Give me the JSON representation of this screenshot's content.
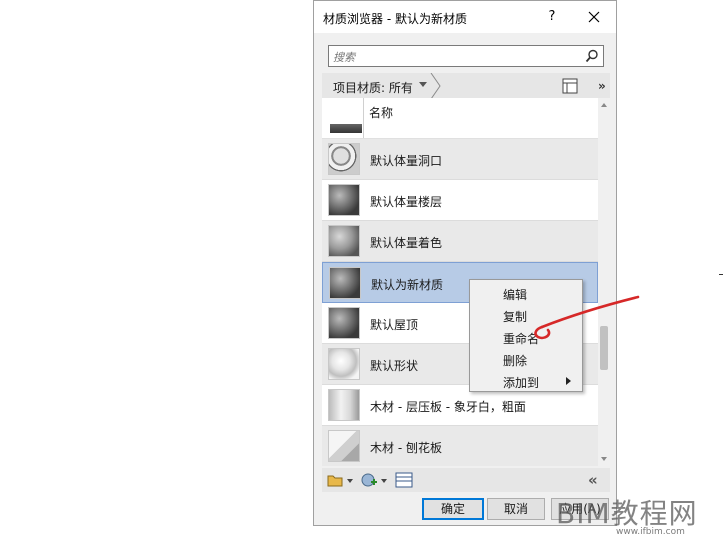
{
  "window": {
    "title": "材质浏览器 - 默认为新材质",
    "help_label": "?"
  },
  "search": {
    "placeholder": "搜索",
    "value": ""
  },
  "filter": {
    "label": "项目材质: 所有"
  },
  "list": {
    "column_header": "名称",
    "items": [
      {
        "label": "默认体量洞口",
        "thumbnail": "holes-sphere"
      },
      {
        "label": "默认体量楼层",
        "thumbnail": "dark-sphere"
      },
      {
        "label": "默认体量着色",
        "thumbnail": "mid-sphere"
      },
      {
        "label": "默认为新材质",
        "thumbnail": "dark-sphere",
        "selected": true
      },
      {
        "label": "默认屋顶",
        "thumbnail": "dark-sphere"
      },
      {
        "label": "默认形状",
        "thumbnail": "glass-sphere"
      },
      {
        "label": "木材 - 层压板 - 象牙白，粗面",
        "thumbnail": "cylinder"
      },
      {
        "label": "木材 - 刨花板",
        "thumbnail": "cube"
      }
    ],
    "scroll_fraction": 0.62
  },
  "context_menu": {
    "items": [
      {
        "label": "编辑"
      },
      {
        "label": "复制"
      },
      {
        "label": "重命名"
      },
      {
        "label": "删除"
      },
      {
        "label": "添加到",
        "has_submenu": true
      }
    ]
  },
  "buttons": {
    "ok": "确定",
    "cancel": "取消",
    "apply": "应用(A)"
  },
  "watermark": {
    "logo": "BIM教程网",
    "url": "www.ifbim.com"
  },
  "colors": {
    "selection": "#b7cbe6",
    "focus_border": "#0078d7",
    "annotation": "#d62828"
  },
  "icons": {
    "search": "magnifier-icon",
    "close": "x-icon",
    "layout": "panel-layout-icon",
    "more": "double-chevron-right-icon",
    "collapse": "double-chevron-left-icon",
    "bottom_toolbar": [
      "material-library-icon",
      "new-material-icon",
      "asset-editor-icon"
    ]
  }
}
